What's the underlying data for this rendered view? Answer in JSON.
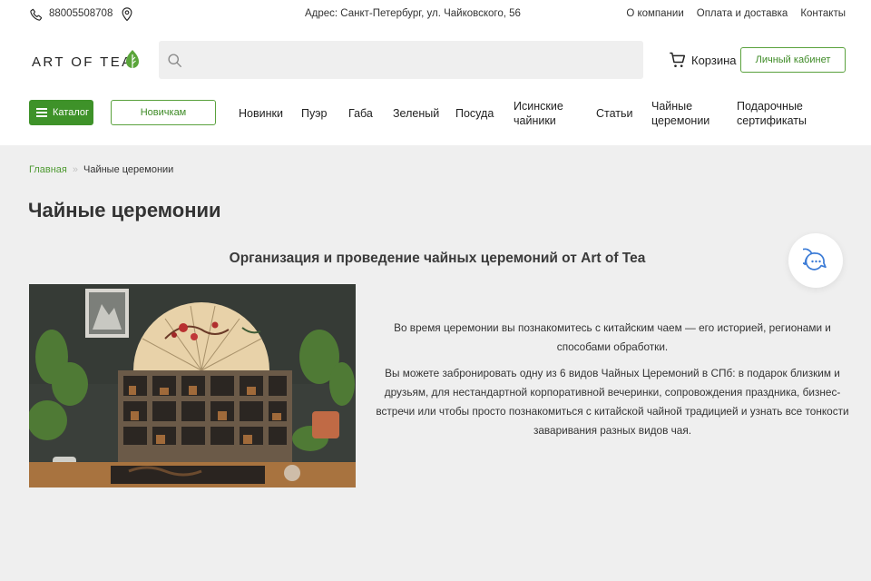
{
  "topbar": {
    "phone": "88005508708",
    "address": "Адрес: Санкт-Петербург, ул. Чайковского, 56",
    "links": [
      "О компании",
      "Оплата и доставка",
      "Контакты"
    ]
  },
  "header": {
    "logo": "ART OF TEA",
    "search": {
      "placeholder": "",
      "value": ""
    },
    "cart_label": "Корзина",
    "account_label": "Личный кабинет",
    "catalog_label": "Каталог",
    "newbie_label": "Новичкам",
    "nav": [
      {
        "label": "Новинки"
      },
      {
        "label": "Пуэр"
      },
      {
        "label": "Габа"
      },
      {
        "label": "Зеленый"
      },
      {
        "label": "Посуда"
      },
      {
        "label": "Исинские чайники"
      },
      {
        "label": "Статьи"
      },
      {
        "label": "Чайные церемонии"
      },
      {
        "label": "Подарочные сертификаты"
      }
    ]
  },
  "breadcrumb": {
    "home": "Главная",
    "separator": "»",
    "current": "Чайные церемонии"
  },
  "page": {
    "title": "Чайные церемонии",
    "subtitle": "Организация и проведение чайных церемоний от Art of Tea",
    "paragraphs": [
      "Во время церемонии вы познакомитесь с китайским чаем — его историей, регионами и способами обработки.",
      "Вы можете забронировать одну из 6 видов Чайных Церемоний в СПб: в подарок близким и друзьям, для нестандартной корпоративной вечеринки, сопровождения праздника, бизнес-встречи или чтобы просто познакомиться с китайской чайной традицией и узнать все тонкости заваривания разных видов чая."
    ]
  },
  "colors": {
    "brand_green": "#3e9229",
    "link_green": "#4f9a33",
    "background": "#efefef",
    "chat_icon": "#3b7bd6"
  },
  "icons": [
    "phone-icon",
    "location-pin-icon",
    "tea-leaf-icon",
    "search-icon",
    "cart-icon",
    "menu-icon",
    "chat-bubbles-icon"
  ]
}
